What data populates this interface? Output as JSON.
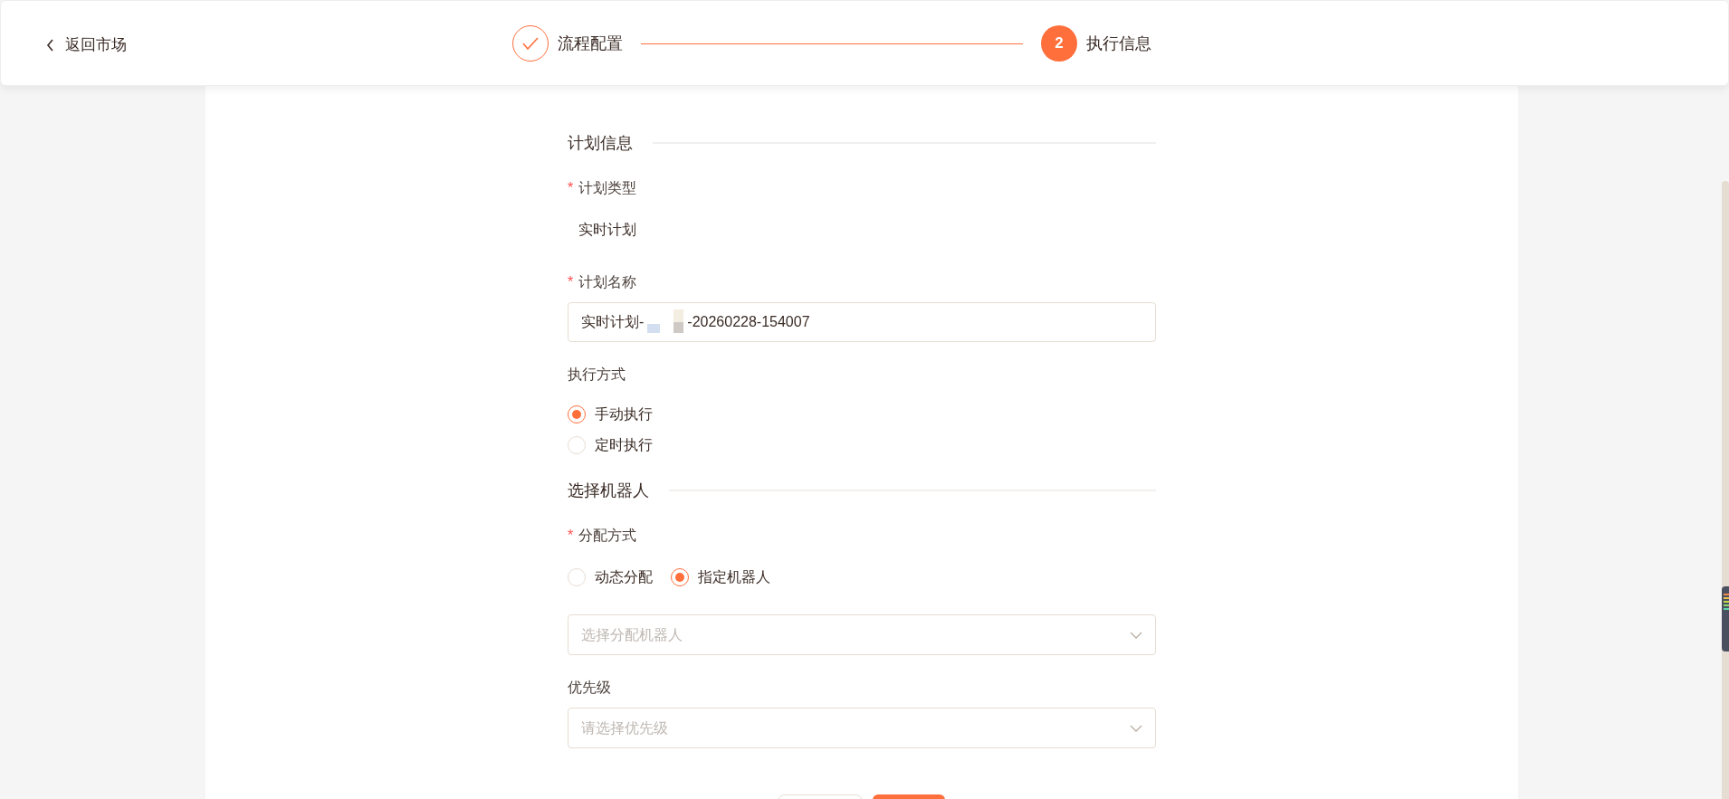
{
  "header": {
    "back_link": "返回市场",
    "steps": [
      {
        "label": "流程配置",
        "done": true
      },
      {
        "number": "2",
        "label": "执行信息",
        "done": false
      }
    ]
  },
  "sections": [
    {
      "title": "计划信息",
      "fields": [
        {
          "kind": "static",
          "label": "计划类型",
          "required_mark": "*",
          "value": "实时计划"
        },
        {
          "kind": "text",
          "label": "计划名称",
          "required_mark": "*",
          "value_parts": [
            "实时计划-",
            "-20260228-154007"
          ]
        },
        {
          "kind": "radio_list",
          "label": "执行方式",
          "options": [
            {
              "label": "手动执行",
              "selected": true
            },
            {
              "label": "定时执行",
              "selected": false
            }
          ]
        }
      ]
    },
    {
      "title": "选择机器人",
      "fields": [
        {
          "kind": "radio_row",
          "label": "分配方式",
          "required_mark": "*",
          "options": [
            {
              "label": "动态分配",
              "selected": false
            },
            {
              "label": "指定机器人",
              "selected": true
            }
          ]
        },
        {
          "kind": "select",
          "placeholder": "选择分配机器人"
        },
        {
          "kind": "select",
          "label": "优先级",
          "placeholder": "请选择优先级"
        }
      ]
    }
  ],
  "buttons": [
    {
      "kind": "secondary"
    },
    {
      "kind": "primary"
    }
  ]
}
